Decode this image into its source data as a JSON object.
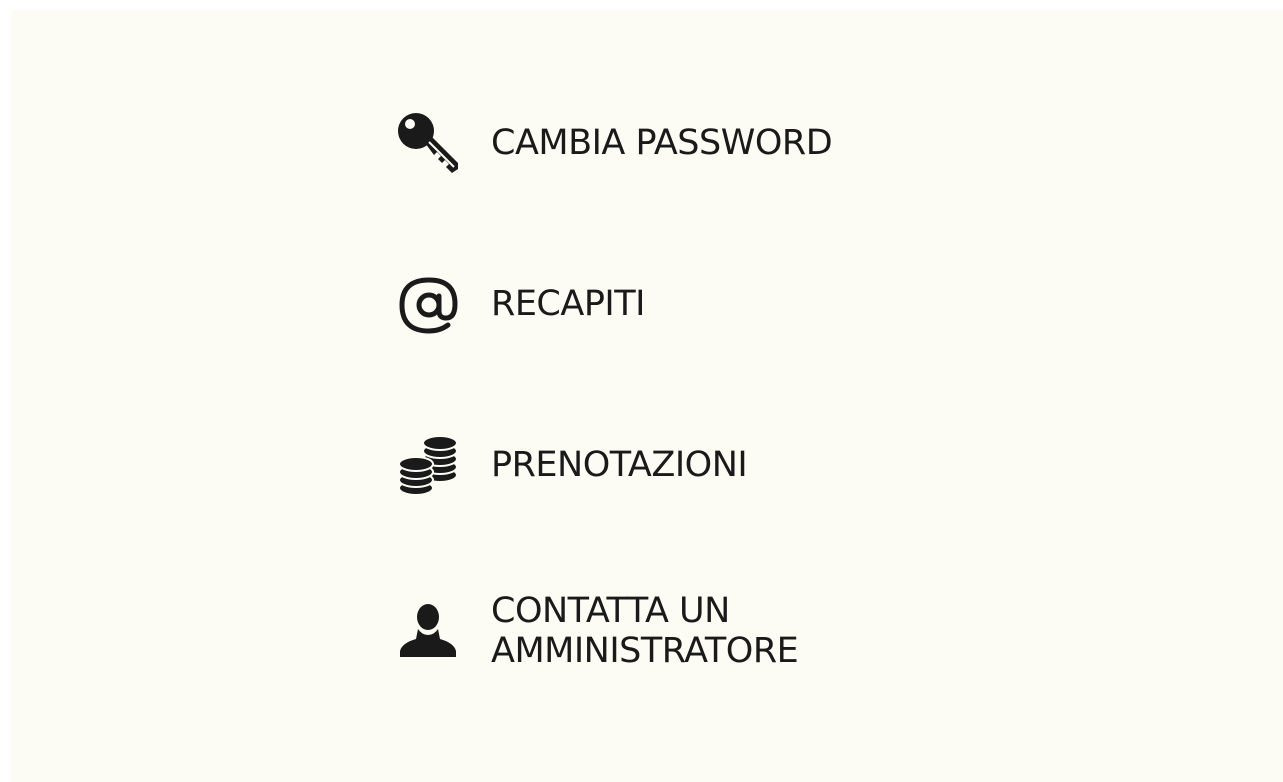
{
  "menu": {
    "items": [
      {
        "label": "CAMBIA PASSWORD",
        "icon": "key-icon"
      },
      {
        "label": "RECAPITI",
        "icon": "at-sign-icon"
      },
      {
        "label": "PRENOTAZIONI",
        "icon": "coins-stack-icon"
      },
      {
        "label": "CONTATTA UN\nAMMINISTRATORE",
        "icon": "user-icon"
      }
    ]
  },
  "colors": {
    "background": "#fcfcf5",
    "text": "#1a1a1a",
    "icon": "#1a1a1a"
  }
}
